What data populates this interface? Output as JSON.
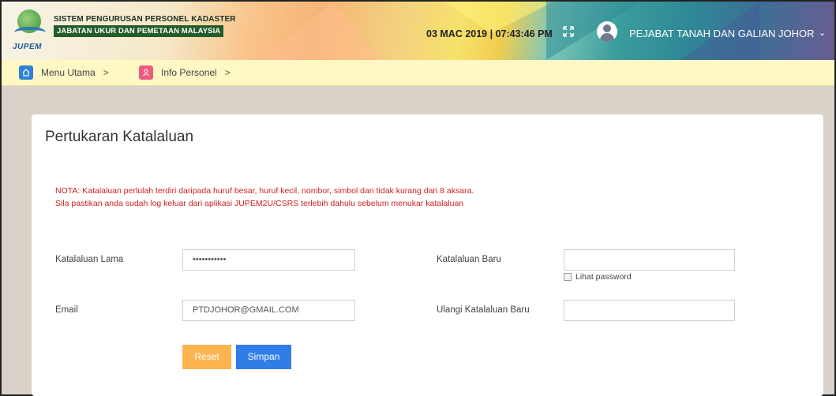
{
  "header": {
    "logo_text": "JUPEM",
    "system_title": "SISTEM PENGURUSAN PERSONEL KADASTER",
    "department": "JABATAN UKUR DAN PEMETAAN MALAYSIA",
    "datetime": "03 MAC 2019 | 07:43:46 PM",
    "user_name": "PEJABAT TANAH DAN GALIAN JOHOR",
    "chevron": "⌄"
  },
  "breadcrumb": {
    "items": [
      {
        "label": "Menu Utama",
        "icon": "home-icon",
        "color": "#2f7fd8"
      },
      {
        "label": "Info Personel",
        "icon": "user-icon",
        "color": "#ec5b7e"
      }
    ],
    "separator": ">"
  },
  "form": {
    "title": "Pertukaran Katalaluan",
    "note_line1": "NOTA: Katalaluan perlulah terdiri daripada huruf besar, huruf kecil, nombor, simbol dan tidak kurang dari 8 aksara.",
    "note_line2": "Sila pastikan anda sudah log keluar dari aplikasi JUPEM2U/CSRS terlebih dahulu sebelum menukar katalaluan",
    "old_password_label": "Katalaluan Lama",
    "old_password_value": "•••••••••••",
    "new_password_label": "Katalaluan Baru",
    "new_password_value": "",
    "show_password_label": "Lihat password",
    "email_label": "Email",
    "email_value": "PTDJOHOR@GMAIL.COM",
    "confirm_password_label": "Ulangi Katalaluan Baru",
    "confirm_password_value": "",
    "reset_label": "Reset",
    "save_label": "Simpan"
  },
  "colors": {
    "reset_button": "#fbb450",
    "save_button": "#2f7ee8",
    "note_text": "#d32020"
  }
}
